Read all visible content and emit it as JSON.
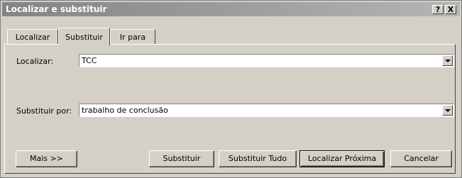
{
  "window": {
    "title": "Localizar e substituir",
    "help_label": "?",
    "close_label": "X"
  },
  "tabs": [
    {
      "label": "Localizar",
      "active": false
    },
    {
      "label": "Substituir",
      "active": true
    },
    {
      "label": "Ir para",
      "active": false
    }
  ],
  "find": {
    "label": "Localizar:",
    "value": "TCC"
  },
  "replace": {
    "label": "Substituir por:",
    "value": "trabalho de conclusão"
  },
  "buttons": {
    "more": "Mais >>",
    "replace": "Substituir",
    "replace_all": "Substituir Tudo",
    "find_next": "Localizar Próxima",
    "cancel": "Cancelar"
  }
}
